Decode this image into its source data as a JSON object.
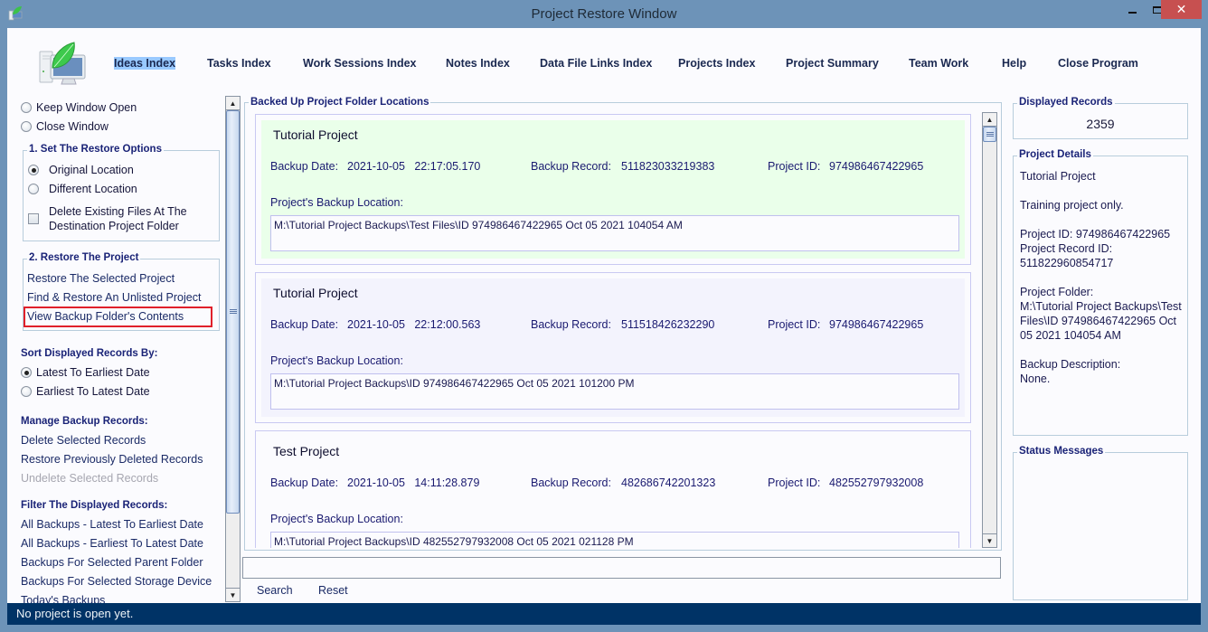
{
  "window": {
    "title": "Project Restore Window",
    "controls": {
      "minimize": "—",
      "maximize": "☐",
      "close": "✕"
    }
  },
  "nav": {
    "items": [
      {
        "label": "Ideas Index",
        "active": true
      },
      {
        "label": "Tasks Index"
      },
      {
        "label": "Work Sessions Index"
      },
      {
        "label": "Notes Index"
      },
      {
        "label": "Data File Links Index"
      },
      {
        "label": "Projects Index"
      },
      {
        "label": "Project Summary"
      },
      {
        "label": "Team Work"
      },
      {
        "label": "Help"
      },
      {
        "label": "Close Program"
      }
    ]
  },
  "left": {
    "window_options": [
      {
        "label": "Keep Window Open",
        "checked": false
      },
      {
        "label": "Close Window",
        "checked": false
      }
    ],
    "restore_options": {
      "title": "1. Set The Restore Options",
      "radios": [
        {
          "label": "Original Location",
          "checked": true
        },
        {
          "label": "Different Location",
          "checked": false
        }
      ],
      "checkbox": {
        "label_line1": "Delete Existing Files At The",
        "label_line2": "Destination Project Folder",
        "checked": false
      }
    },
    "restore_project": {
      "title": "2. Restore The Project",
      "links": [
        "Restore The Selected Project",
        "Find & Restore An Unlisted Project",
        "View Backup Folder's Contents"
      ]
    },
    "sort": {
      "title": "Sort Displayed Records By:",
      "options": [
        {
          "label": "Latest To Earliest Date",
          "checked": true
        },
        {
          "label": "Earliest To Latest Date",
          "checked": false
        }
      ]
    },
    "manage": {
      "title": "Manage Backup Records:",
      "links": [
        "Delete Selected Records",
        "Restore Previously Deleted Records"
      ],
      "disabled_link": "Undelete Selected Records"
    },
    "filter": {
      "title": "Filter The Displayed Records:",
      "links": [
        "All Backups - Latest To Earliest Date",
        "All Backups - Earliest To Latest Date",
        "Backups For Selected Parent Folder",
        "Backups For Selected Storage Device",
        "Today's Backups"
      ]
    }
  },
  "center": {
    "title": "Backed Up Project Folder Locations",
    "labels": {
      "backup_date": "Backup Date:",
      "backup_record": "Backup Record:",
      "project_id": "Project ID:",
      "location": "Project's Backup Location:"
    },
    "records": [
      {
        "name": "Tutorial Project",
        "date": "2021-10-05   22:17:05.170",
        "backup_record": "511823033219383",
        "project_id": "974986467422965",
        "location": "M:\\Tutorial Project Backups\\Test Files\\ID 974986467422965 Oct 05 2021 104054 AM",
        "selected": true
      },
      {
        "name": "Tutorial Project",
        "date": "2021-10-05   22:12:00.563",
        "backup_record": "511518426232290",
        "project_id": "974986467422965",
        "location": "M:\\Tutorial Project Backups\\ID 974986467422965 Oct 05 2021 101200 PM"
      },
      {
        "name": "Test Project",
        "date": "2021-10-05   14:11:28.879",
        "backup_record": "482686742201323",
        "project_id": "482552797932008",
        "location": "M:\\Tutorial Project Backups\\ID 482552797932008 Oct 05 2021 021128 PM"
      }
    ],
    "search": {
      "value": "",
      "search_label": "Search",
      "reset_label": "Reset"
    }
  },
  "right": {
    "displayed_records": {
      "title": "Displayed Records",
      "count": "2359"
    },
    "project_details": {
      "title": "Project Details",
      "text": "Tutorial Project\n\nTraining project only.\n\nProject ID:  974986467422965\nProject Record ID:\n511822960854717\n\nProject Folder:\nM:\\Tutorial Project Backups\\Test\nFiles\\ID 974986467422965 Oct\n05 2021 104054 AM\n\nBackup Description:\nNone."
    },
    "status_messages": {
      "title": "Status Messages",
      "text": ""
    }
  },
  "statusbar": {
    "text": "No project is open yet."
  },
  "colors": {
    "titlebar": "#6d93b8",
    "statusbar": "#003366",
    "selected_record": "#eaffea",
    "alt_record": "#f3f3fd",
    "highlight_border": "#e0202a",
    "heading": "#1a2377"
  }
}
